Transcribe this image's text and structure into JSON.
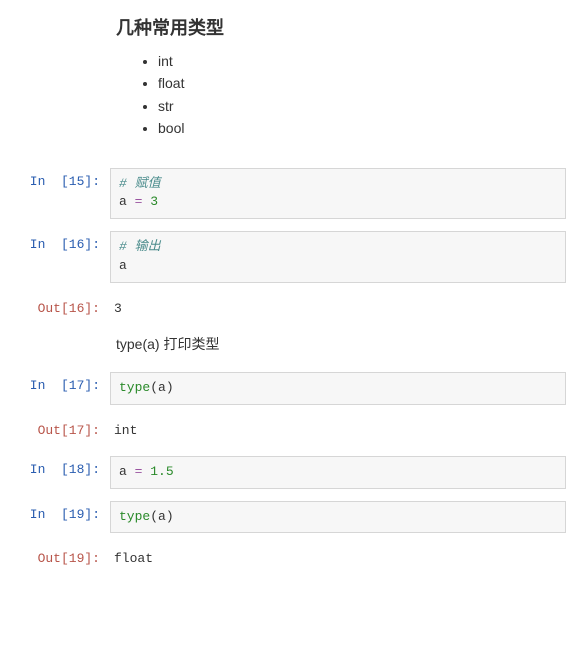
{
  "heading": "几种常用类型",
  "types_list": [
    "int",
    "float",
    "str",
    "bool"
  ],
  "markdown_note": "type(a) 打印类型",
  "cells": {
    "c15": {
      "prompt_in": "In  [15]:",
      "code": {
        "comment": "# 赋值",
        "var": "a",
        "op": "=",
        "num": "3"
      }
    },
    "c16": {
      "prompt_in": "In  [16]:",
      "prompt_out": "Out[16]:",
      "code": {
        "comment": "# 输出",
        "var": "a"
      },
      "output": "3"
    },
    "c17": {
      "prompt_in": "In  [17]:",
      "prompt_out": "Out[17]:",
      "code": {
        "builtin": "type",
        "paren_open": "(",
        "var": "a",
        "paren_close": ")"
      },
      "output": "int"
    },
    "c18": {
      "prompt_in": "In  [18]:",
      "code": {
        "var": "a",
        "op": "=",
        "num": "1.5"
      }
    },
    "c19": {
      "prompt_in": "In  [19]:",
      "prompt_out": "Out[19]:",
      "code": {
        "builtin": "type",
        "paren_open": "(",
        "var": "a",
        "paren_close": ")"
      },
      "output": "float"
    }
  }
}
